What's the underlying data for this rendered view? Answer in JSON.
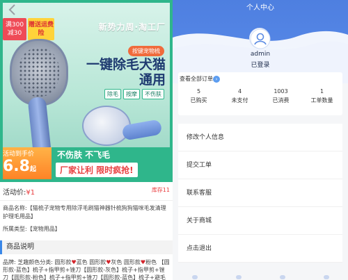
{
  "left": {
    "hero": {
      "badge_full": "满300减30",
      "badge_gift": "赠送运费险",
      "brand": "新势力周·淘工厂",
      "tag": "按键宠物梳",
      "title": "一键除毛犬猫通用",
      "chips": [
        "除毛",
        "按摩",
        "不伤肤"
      ],
      "promo_label": "活动到手价",
      "promo_price": "6.8",
      "promo_price_suffix": "起",
      "promo_slogan": "不伤肤 不飞毛",
      "promo_banner": "厂家让利 限时疯抢!"
    },
    "price_label": "活动价:",
    "price_value": "¥1",
    "stock": "库存11",
    "product_name": "商品名称:【猫梳子宠物专用除浮毛刷猫神器针梳狗狗猫咪毛发清理护理毛用品】",
    "category": "所属类型:【宠物用品】",
    "desc_title": "商品说明",
    "desc_part1": "品牌: 芝趣颜色分类: 圆形款",
    "desc_part2": "蓝色 圆形款",
    "desc_part3": "灰色 圆形款",
    "desc_part4": "粉色 【圆形款-蓝色】梳子+指甲剪+锉刀【圆形款-灰色】梳子+指甲剪+锉刀【圆形款-粉色】梳子+指甲剪+锉刀【圆形款-蓝色】梳子+避毛油【圆形款-灰"
  },
  "right": {
    "title": "个人中心",
    "username": "admin",
    "login_status": "已登录",
    "view_all_orders": "查看全部订单",
    "stats": [
      {
        "num": "5",
        "label": "已购买"
      },
      {
        "num": "4",
        "label": "未支付"
      },
      {
        "num": "1003",
        "label": "已消费"
      },
      {
        "num": "1",
        "label": "工单数量"
      }
    ],
    "menu": [
      "修改个人信息",
      "提交工单",
      "联系客服",
      "关于商城",
      "点击退出"
    ]
  },
  "colors": {
    "accent_blue": "#4e7fe0",
    "price_red": "#e93b3d",
    "hero_green": "#2fb68b"
  }
}
